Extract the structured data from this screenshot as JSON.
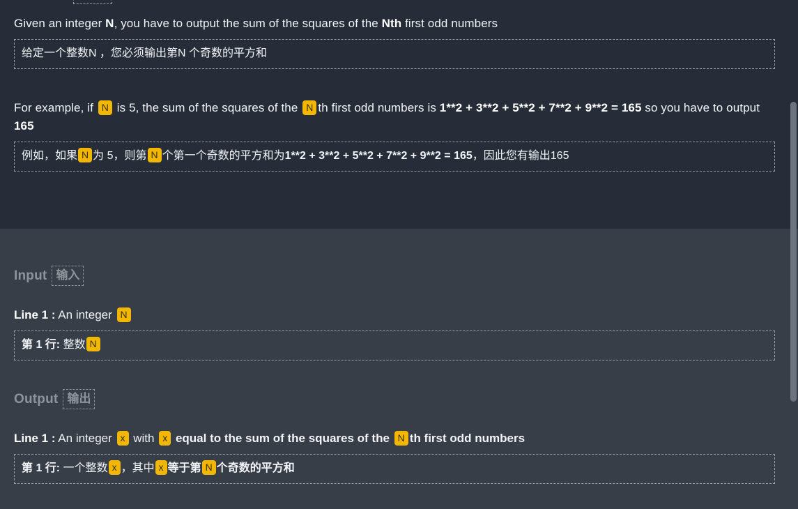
{
  "theme": {
    "bg_top": "#262d38",
    "bg_bottom": "#373e48",
    "text": "#f2f4f7",
    "muted": "#8d949c",
    "badge_bg": "#f2b705",
    "badge_text": "#3a3205",
    "dashed_border": "#9aa3ad",
    "scrollbar_thumb": "#6c7480"
  },
  "statement": {
    "intro": {
      "en_part1": "Given an integer ",
      "en_var1": "N",
      "en_part2": ", you have to output the sum of the squares of the ",
      "en_bold": "Nth",
      "en_part3": " first odd numbers",
      "zh": "给定一个整数N ，您必须输出第N 个奇数的平方和"
    },
    "example": {
      "en_p1": "For example, if ",
      "en_v1": "N",
      "en_p2": " is 5, the sum of the squares of the ",
      "en_v2": "N",
      "en_p3": "th first odd numbers is ",
      "en_b1": "1**2 + 3**2 + 5**2 + 7**2 + 9**2 = 165",
      "en_p4": " so you have to output ",
      "en_b2": "165",
      "zh_p1": "例如，如果",
      "zh_v1": "N",
      "zh_p2": "为 5，则第",
      "zh_v2": "N",
      "zh_p3": "个第一个奇数的平方和为",
      "zh_b1": "1**2 + 3**2 + 5**2 + 7**2 + 9**2 = 165",
      "zh_p4": "，因此您有输出165"
    }
  },
  "input_section": {
    "heading": "Input",
    "heading_translation": "输入",
    "line_lead": "Line 1 :",
    "line_text": " An integer ",
    "line_var": "N",
    "zh_lead": "第 1 行:",
    "zh_text": " 整数",
    "zh_var": "N"
  },
  "output_section": {
    "heading": "Output",
    "heading_translation": "输出",
    "line_lead": "Line 1 :",
    "line_p1": " An integer ",
    "line_v1": "x",
    "line_p2": " with ",
    "line_v2": "x",
    "line_b1": " equal to the sum of the squares of the ",
    "line_v3": "N",
    "line_b2": "th first odd numbers",
    "zh_lead": "第 1 行:",
    "zh_p1": " 一个整数",
    "zh_v1": "x",
    "zh_p2": "，其中",
    "zh_v2": "x",
    "zh_b1": "等于第",
    "zh_v3": "N",
    "zh_b2": "个奇数的平方和"
  },
  "scrollbar": {
    "name": "vertical-scrollbar"
  }
}
